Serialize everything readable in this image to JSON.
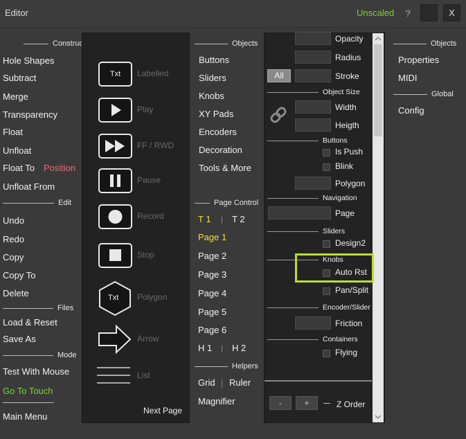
{
  "titlebar": {
    "title": "Editor",
    "unscaled": "Unscaled",
    "help": "?",
    "close": "X"
  },
  "left": {
    "constructor_header": "Constructor",
    "constructor_items": [
      "Hole Shapes",
      "Subtract",
      "Merge",
      "Transparency",
      "Float",
      "Unfloat"
    ],
    "float_to": "Float To",
    "position": "Position",
    "unfloat_from": "Unfloat From",
    "edit_header": "Edit",
    "edit_items": [
      "Undo",
      "Redo",
      "Copy",
      "Copy To",
      "Delete"
    ],
    "files_header": "Files",
    "files_items": [
      "Load & Reset",
      "Save As"
    ],
    "mode_header": "Mode",
    "test_with_mouse": "Test With Mouse",
    "go_to_touch": "Go To Touch",
    "main_menu": "Main Menu"
  },
  "middle": {
    "items": [
      {
        "label": "Labelled",
        "icon": "txt-icon",
        "text": "Txt"
      },
      {
        "label": "Play",
        "icon": "play-icon"
      },
      {
        "label": "FF / RWD",
        "icon": "fast-forward-icon"
      },
      {
        "label": "Pause",
        "icon": "pause-icon"
      },
      {
        "label": "Record",
        "icon": "record-icon"
      },
      {
        "label": "Stop",
        "icon": "stop-icon"
      },
      {
        "label": "Polygon",
        "icon": "hexagon-icon",
        "text": "Txt"
      },
      {
        "label": "Arrow",
        "icon": "arrow-icon"
      },
      {
        "label": "List",
        "icon": "list-icon"
      }
    ],
    "next_page": "Next Page"
  },
  "objects": {
    "header": "Objects",
    "items": [
      "Buttons",
      "Sliders",
      "Knobs",
      "XY Pads",
      "Encoders",
      "Decoration",
      "Tools & More"
    ],
    "page_control_header": "Page Control",
    "t1": "T 1",
    "t2": "T 2",
    "pages": [
      "Page 1",
      "Page 2",
      "Page 3",
      "Page 4",
      "Page 5",
      "Page 6"
    ],
    "h1": "H 1",
    "h2": "H 2",
    "helpers_header": "Helpers",
    "grid": "Grid",
    "ruler": "Ruler",
    "magnifier": "Magnifier"
  },
  "props": {
    "opacity": "Opacity",
    "radius": "Radius",
    "all": "All",
    "stroke": "Stroke",
    "object_size": "Object Size",
    "width": "Width",
    "height": "Heigth",
    "buttons_header": "Buttons",
    "is_push": "Is Push",
    "blink": "Blink",
    "polygon": "Polygon",
    "navigation_header": "Navigation",
    "page": "Page",
    "sliders_header": "Sliders",
    "design2": "Design2",
    "knobs_header": "Knobs",
    "auto_rst": "Auto Rst",
    "pan_split": "Pan/Split",
    "encoder_header": "Encoder/Slider",
    "friction": "Friction",
    "containers_header": "Containers",
    "flying": "Flying",
    "minus": "-",
    "plus": "+",
    "z_order": "Z Order"
  },
  "right": {
    "objects_header": "Objects",
    "properties": "Properties",
    "midi": "MIDI",
    "global_header": "Global",
    "config": "Config"
  },
  "colors": {
    "accent_green": "#7cd62a",
    "highlight": "#b7e22a",
    "position_red": "#e07070",
    "active_yellow": "#f0e030"
  }
}
